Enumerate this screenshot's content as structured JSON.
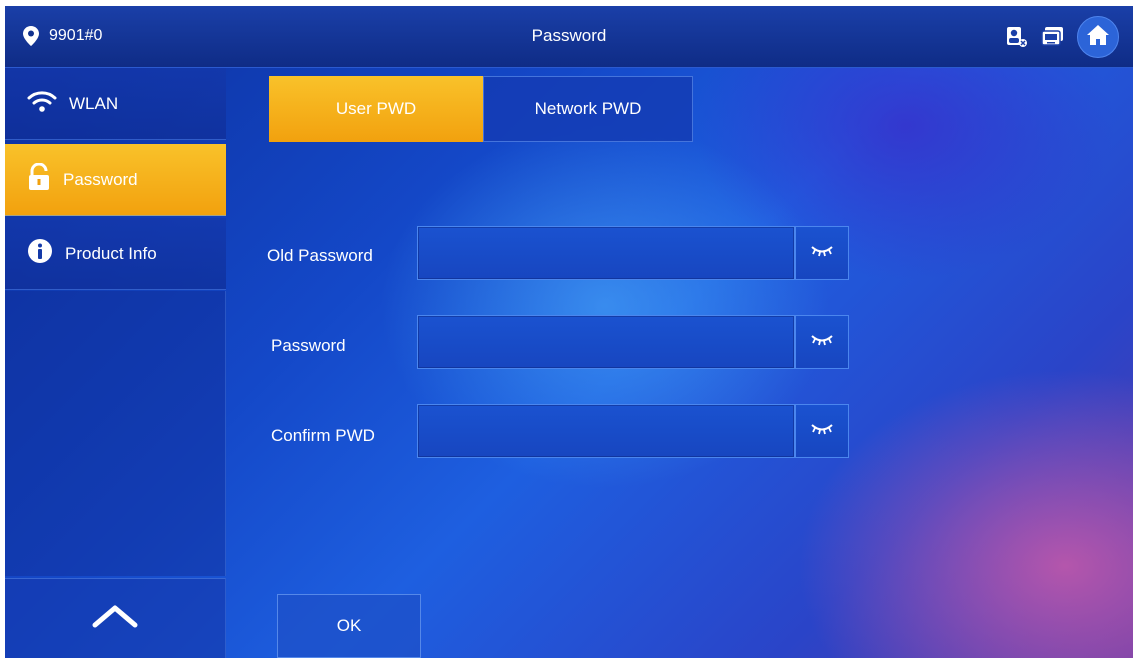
{
  "header": {
    "location": "9901#0",
    "title": "Password",
    "icons": [
      "location-pin-icon",
      "contact-card-icon",
      "monitor-icon",
      "home-icon"
    ]
  },
  "sidebar": {
    "items": [
      {
        "label": "WLAN",
        "icon": "wifi-icon",
        "active": false
      },
      {
        "label": "Password",
        "icon": "lock-icon",
        "active": true
      },
      {
        "label": "Product Info",
        "icon": "info-icon",
        "active": false
      }
    ],
    "scroll_up_icon": "chevron-up-icon"
  },
  "tabs": [
    {
      "label": "User PWD",
      "active": true
    },
    {
      "label": "Network PWD",
      "active": false
    }
  ],
  "form": {
    "old_password": {
      "label": "Old Password",
      "value": ""
    },
    "password": {
      "label": "Password",
      "value": ""
    },
    "confirm": {
      "label": "Confirm PWD",
      "value": ""
    },
    "toggle_icon": "eye-closed-icon"
  },
  "ok_label": "OK",
  "colors": {
    "accent": "#f5ad18",
    "background": "#1a52d0"
  }
}
